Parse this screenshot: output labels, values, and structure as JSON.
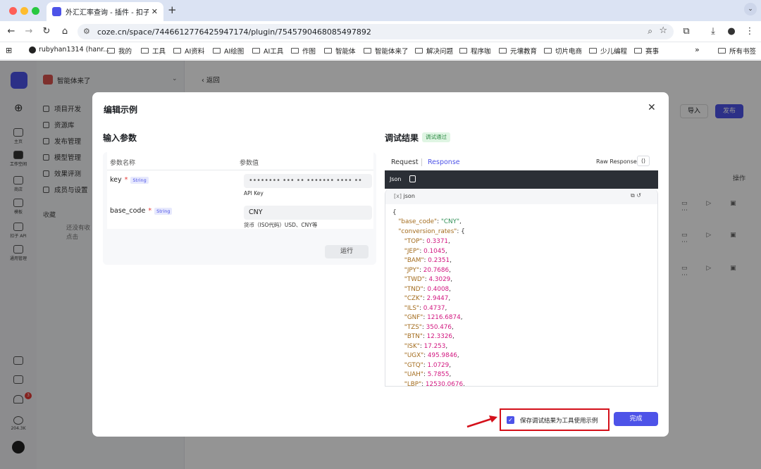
{
  "browser": {
    "tab_title": "外汇汇率查询 - 插件 - 扣子",
    "url": "coze.cn/space/7446612776425947174/plugin/7545790468085497892",
    "bookmarks": [
      "rubyhan1314 (hanr...",
      "我的",
      "工具",
      "AI资料",
      "AI绘图",
      "AI工具",
      "作图",
      "智能体",
      "智能体来了",
      "解决问题",
      "程序咖",
      "元壤教育",
      "切片电商",
      "少儿编程",
      "赛事"
    ],
    "all_bookmarks": "所有书签",
    "more": "»"
  },
  "app": {
    "workspace_name": "智能体来了",
    "back": "返回",
    "left_rail": [
      "主页",
      "工作空间",
      "商店",
      "模板",
      "扣子 API",
      "通用管理"
    ],
    "credits": "204.3K",
    "notif_count": "3",
    "nav": [
      "项目开发",
      "资源库",
      "发布管理",
      "模型管理",
      "效果评测",
      "成员与设置"
    ],
    "favorites": "收藏",
    "fav_hint1": "还没有收",
    "fav_hint2": "点击",
    "import_btn": "导入",
    "publish_btn": "发布",
    "ops_header": "操作"
  },
  "modal": {
    "title": "编辑示例",
    "input_title": "输入参数",
    "col_name": "参数名称",
    "col_value": "参数值",
    "params": [
      {
        "name": "key",
        "type": "String",
        "value": "•••••••• ••• •• ••••••• •••• ••",
        "hint": "API Key"
      },
      {
        "name": "base_code",
        "type": "String",
        "value": "CNY",
        "hint": "货币（ISO代码）USD、CNY等"
      }
    ],
    "run_btn": "运行",
    "result_title": "调试结果",
    "result_badge": "调试通过",
    "tab_request": "Request",
    "tab_response": "Response",
    "raw_response": "Raw Response",
    "json_tab": "Json",
    "json_label": "json",
    "response": {
      "base_code": "CNY",
      "rates": [
        [
          "TOP",
          "0.3371"
        ],
        [
          "JEP",
          "0.1045"
        ],
        [
          "BAM",
          "0.2351"
        ],
        [
          "JPY",
          "20.7686"
        ],
        [
          "TWD",
          "4.3029"
        ],
        [
          "TND",
          "0.4008"
        ],
        [
          "CZK",
          "2.9447"
        ],
        [
          "ILS",
          "0.4737"
        ],
        [
          "GNF",
          "1216.6874"
        ],
        [
          "TZS",
          "350.476"
        ],
        [
          "BTN",
          "12.3326"
        ],
        [
          "ISK",
          "17.253"
        ],
        [
          "UGX",
          "495.9846"
        ],
        [
          "GTQ",
          "1.0729"
        ],
        [
          "UAH",
          "5.7855"
        ],
        [
          "LBP",
          "12530.0676"
        ]
      ]
    },
    "save_label": "保存调试结果为工具使用示例",
    "done_btn": "完成"
  },
  "colors": {
    "accent": "#4d53e8",
    "highlight": "#d4101a"
  }
}
